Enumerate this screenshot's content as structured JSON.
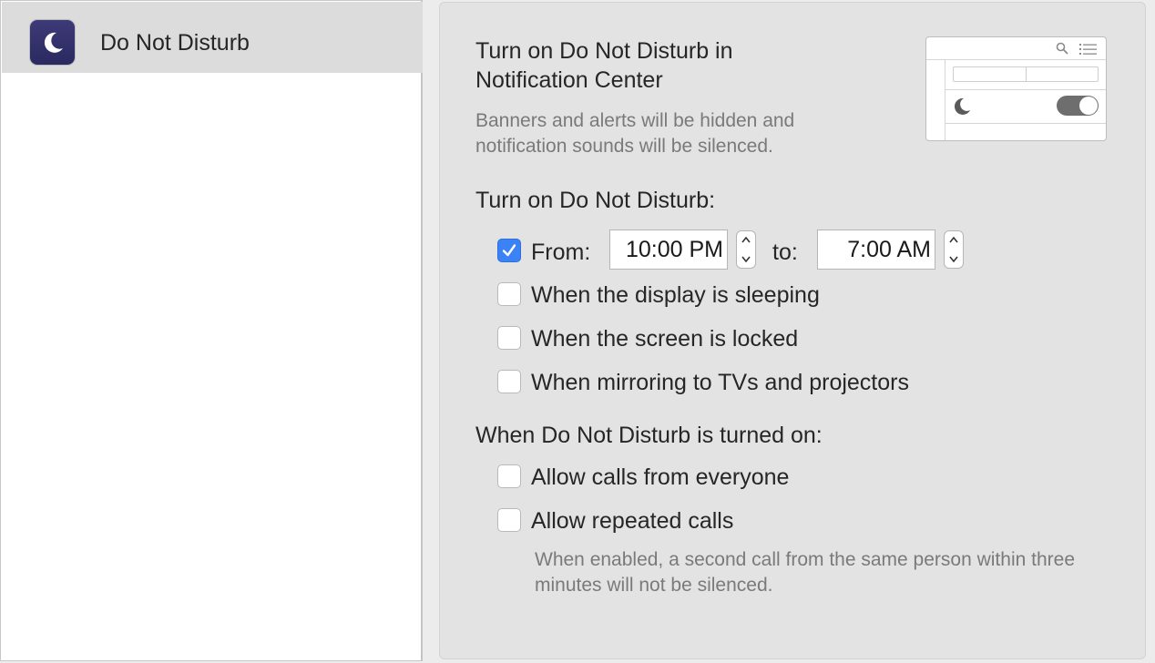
{
  "sidebar": {
    "items": [
      {
        "label": "Do Not Disturb",
        "icon": "moon-icon",
        "selected": true
      }
    ]
  },
  "panel": {
    "notification_center_heading": "Turn on Do Not Disturb in Notification Center",
    "notification_center_desc": "Banners and alerts will be hidden and notification sounds will be silenced.",
    "schedule_heading": "Turn on Do Not Disturb:",
    "from": {
      "label": "From:",
      "checked": true,
      "value": "10:00 PM"
    },
    "to": {
      "label": "to:",
      "value": "7:00 AM"
    },
    "options": [
      {
        "label": "When the display is sleeping",
        "checked": false
      },
      {
        "label": "When the screen is locked",
        "checked": false
      },
      {
        "label": "When mirroring to TVs and projectors",
        "checked": false
      }
    ],
    "when_on_heading": "When Do Not Disturb is turned on:",
    "call_options": [
      {
        "label": "Allow calls from everyone",
        "checked": false
      },
      {
        "label": "Allow repeated calls",
        "checked": false
      }
    ],
    "repeated_calls_desc": "When enabled, a second call from the same person within three minutes will not be silenced."
  },
  "colors": {
    "accent": "#3b82f6",
    "icon_bg": "#2f2c66",
    "panel_bg": "#e3e3e3",
    "sidebar_selected": "#dcdcdc"
  }
}
